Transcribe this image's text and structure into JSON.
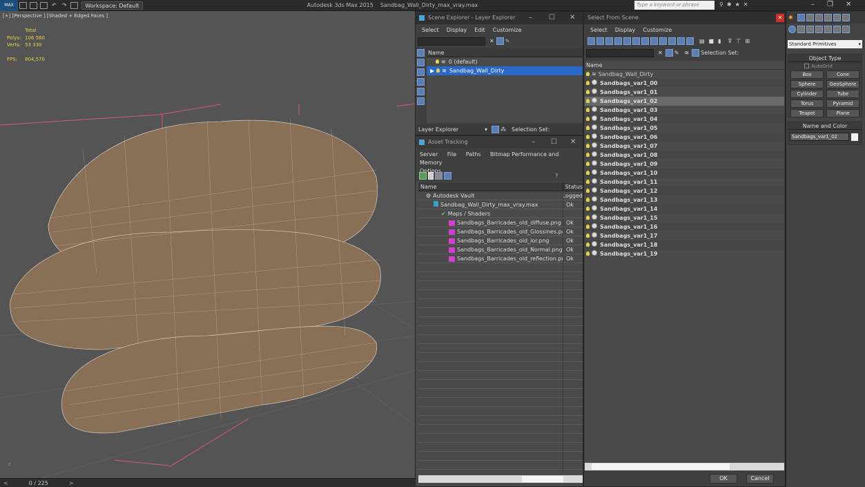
{
  "app": {
    "title": "Autodesk 3ds Max  2015",
    "file": "Sandbag_Wall_Dirty_max_vray.max",
    "workspace": "Workspace: Default",
    "search_placeholder": "Type a keyword or phrase"
  },
  "viewport": {
    "label": "[+] [Perspective ] [Shaded + Edged Faces ]",
    "stats": {
      "total": "Total",
      "polys_label": "Polys:",
      "polys": "106 560",
      "verts_label": "Verts:",
      "verts": "53 330",
      "fps_label": "FPS:",
      "fps": "804,570"
    }
  },
  "status": {
    "frame": "0 / 225"
  },
  "scene_explorer": {
    "title": "Scene Explorer - Layer Explorer",
    "menu": [
      "Select",
      "Display",
      "Edit",
      "Customize"
    ],
    "col_name": "Name",
    "rows": [
      "0 (default)",
      "Sandbag_Wall_Dirty"
    ],
    "layer_dropdown": "Layer Explorer",
    "selection_set": "Selection Set:"
  },
  "asset_tracking": {
    "title": "Asset Tracking",
    "menu": [
      "Server",
      "File",
      "Paths",
      "Bitmap Performance and Memory"
    ],
    "options": "Options",
    "col_name": "Name",
    "col_status": "Status",
    "rows": [
      {
        "name": "Autodesk Vault",
        "status": "Logged",
        "indent": 1
      },
      {
        "name": "Sandbag_Wall_Dirty_max_vray.max",
        "status": "Ok",
        "indent": 2
      },
      {
        "name": "Maps / Shaders",
        "status": "",
        "indent": 3
      },
      {
        "name": "Sandbags_Barricades_old_diffuse.png",
        "status": "Ok",
        "indent": 4
      },
      {
        "name": "Sandbags_Barricades_old_Glossines.png",
        "status": "Ok",
        "indent": 4
      },
      {
        "name": "Sandbags_Barricades_old_ior.png",
        "status": "Ok",
        "indent": 4
      },
      {
        "name": "Sandbags_Barricades_old_Normal.png",
        "status": "Ok",
        "indent": 4
      },
      {
        "name": "Sandbags_Barricades_old_reflection.png",
        "status": "Ok",
        "indent": 4
      }
    ]
  },
  "select_from_scene": {
    "title": "Select From Scene",
    "menu": [
      "Select",
      "Display",
      "Customize"
    ],
    "selection_set": "Selection Set:",
    "col_name": "Name",
    "root": "Sandbag_Wall_Dirty",
    "items": [
      "Sandbags_var1_00",
      "Sandbags_var1_01",
      "Sandbags_var1_02",
      "Sandbags_var1_03",
      "Sandbags_var1_04",
      "Sandbags_var1_05",
      "Sandbags_var1_06",
      "Sandbags_var1_07",
      "Sandbags_var1_08",
      "Sandbags_var1_09",
      "Sandbags_var1_10",
      "Sandbags_var1_11",
      "Sandbags_var1_12",
      "Sandbags_var1_13",
      "Sandbags_var1_14",
      "Sandbags_var1_15",
      "Sandbags_var1_16",
      "Sandbags_var1_17",
      "Sandbags_var1_18",
      "Sandbags_var1_19"
    ],
    "selected_index": 2,
    "ok": "OK",
    "cancel": "Cancel"
  },
  "command_panel": {
    "dropdown": "Standard Primitives",
    "object_type": "Object Type",
    "autogrid": "AutoGrid",
    "buttons": [
      "Box",
      "Cone",
      "Sphere",
      "GeoSphere",
      "Cylinder",
      "Tube",
      "Torus",
      "Pyramid",
      "Teapot",
      "Plane"
    ],
    "name_color": "Name and Color",
    "object_name": "Sandbags_var1_02"
  }
}
